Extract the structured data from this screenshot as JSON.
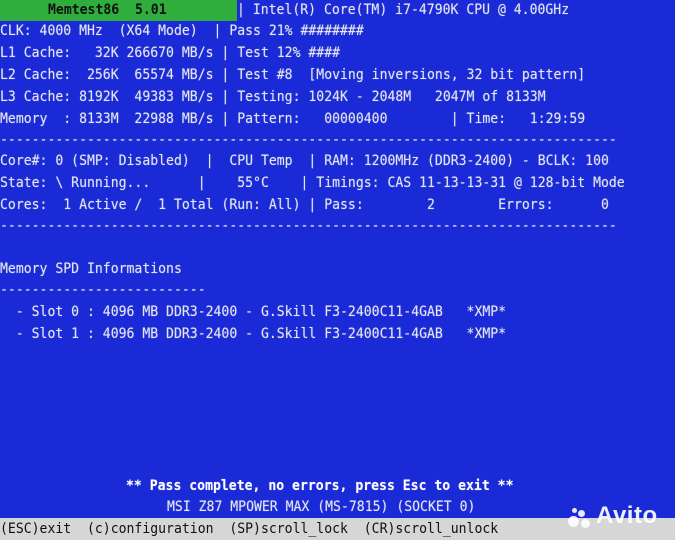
{
  "header": {
    "program_title": "Memtest86  5.01",
    "cpu": "| Intel(R) Core(TM) i7-4790K CPU @ 4.00GHz"
  },
  "lines": {
    "clk": "CLK: 4000 MHz  (X64 Mode)  | Pass 21% ########",
    "l1": "L1 Cache:   32K 266670 MB/s | Test 12% ####",
    "l2": "L2 Cache:  256K  65574 MB/s | Test #8  [Moving inversions, 32 bit pattern]",
    "l3": "L3 Cache: 8192K  49383 MB/s | Testing: 1024K - 2048M   2047M of 8133M",
    "memory": "Memory  : 8133M  22988 MB/s | Pattern:   00000400        | Time:   1:29:59",
    "sep1": "------------------------------------------------------------------------------",
    "core": "Core#: 0 (SMP: Disabled)  |  CPU Temp  | RAM: 1200MHz (DDR3-2400) - BCLK: 100",
    "state": "State: \\ Running...      |    55°C    | Timings: CAS 11-13-13-31 @ 128-bit Mode",
    "cores": "Cores:  1 Active /  1 Total (Run: All) | Pass:        2        Errors:      0",
    "sep2": "------------------------------------------------------------------------------"
  },
  "spd": {
    "heading": "Memory SPD Informations",
    "underline": "--------------------------",
    "slots": [
      "  - Slot 0 : 4096 MB DDR3-2400 - G.Skill F3-2400C11-4GAB   *XMP*",
      "  - Slot 1 : 4096 MB DDR3-2400 - G.Skill F3-2400C11-4GAB   *XMP*"
    ]
  },
  "footer": {
    "message": "** Pass complete, no errors, press Esc to exit **",
    "board": "MSI Z87 MPOWER MAX (MS-7815) (SOCKET 0)"
  },
  "menu": {
    "text": "(ESC)exit  (c)configuration  (SP)scroll_lock  (CR)scroll_unlock"
  },
  "watermark": "Avito",
  "colors": {
    "background": "#1a2ad6",
    "title_block": "#2fad3d",
    "menu_bar": "#d6d6d6"
  }
}
